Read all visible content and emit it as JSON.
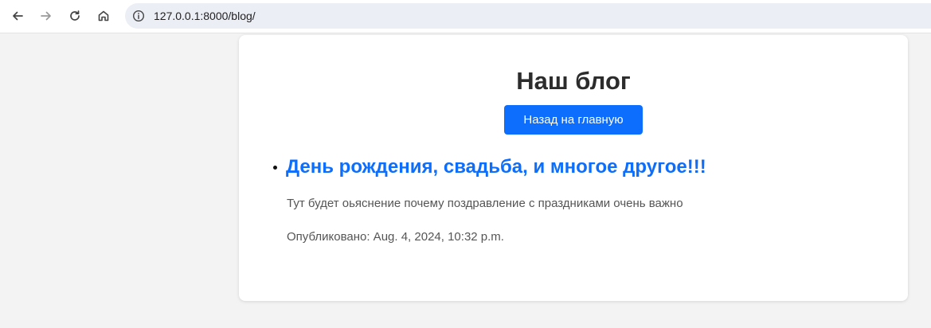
{
  "browser": {
    "url": "127.0.0.1:8000/blog/"
  },
  "page": {
    "title": "Наш блог",
    "home_button_label": "Назад на главную",
    "posts": [
      {
        "title": "День рождения, свадьба, и многое другое!!!",
        "excerpt": "Тут будет оьяснение почему поздравление с праздниками очень важно",
        "published": "Опубликовано: Aug. 4, 2024, 10:32 p.m."
      }
    ]
  },
  "colors": {
    "accent": "#0d6efd",
    "page_bg": "#f3f3f3",
    "card_bg": "#ffffff"
  }
}
